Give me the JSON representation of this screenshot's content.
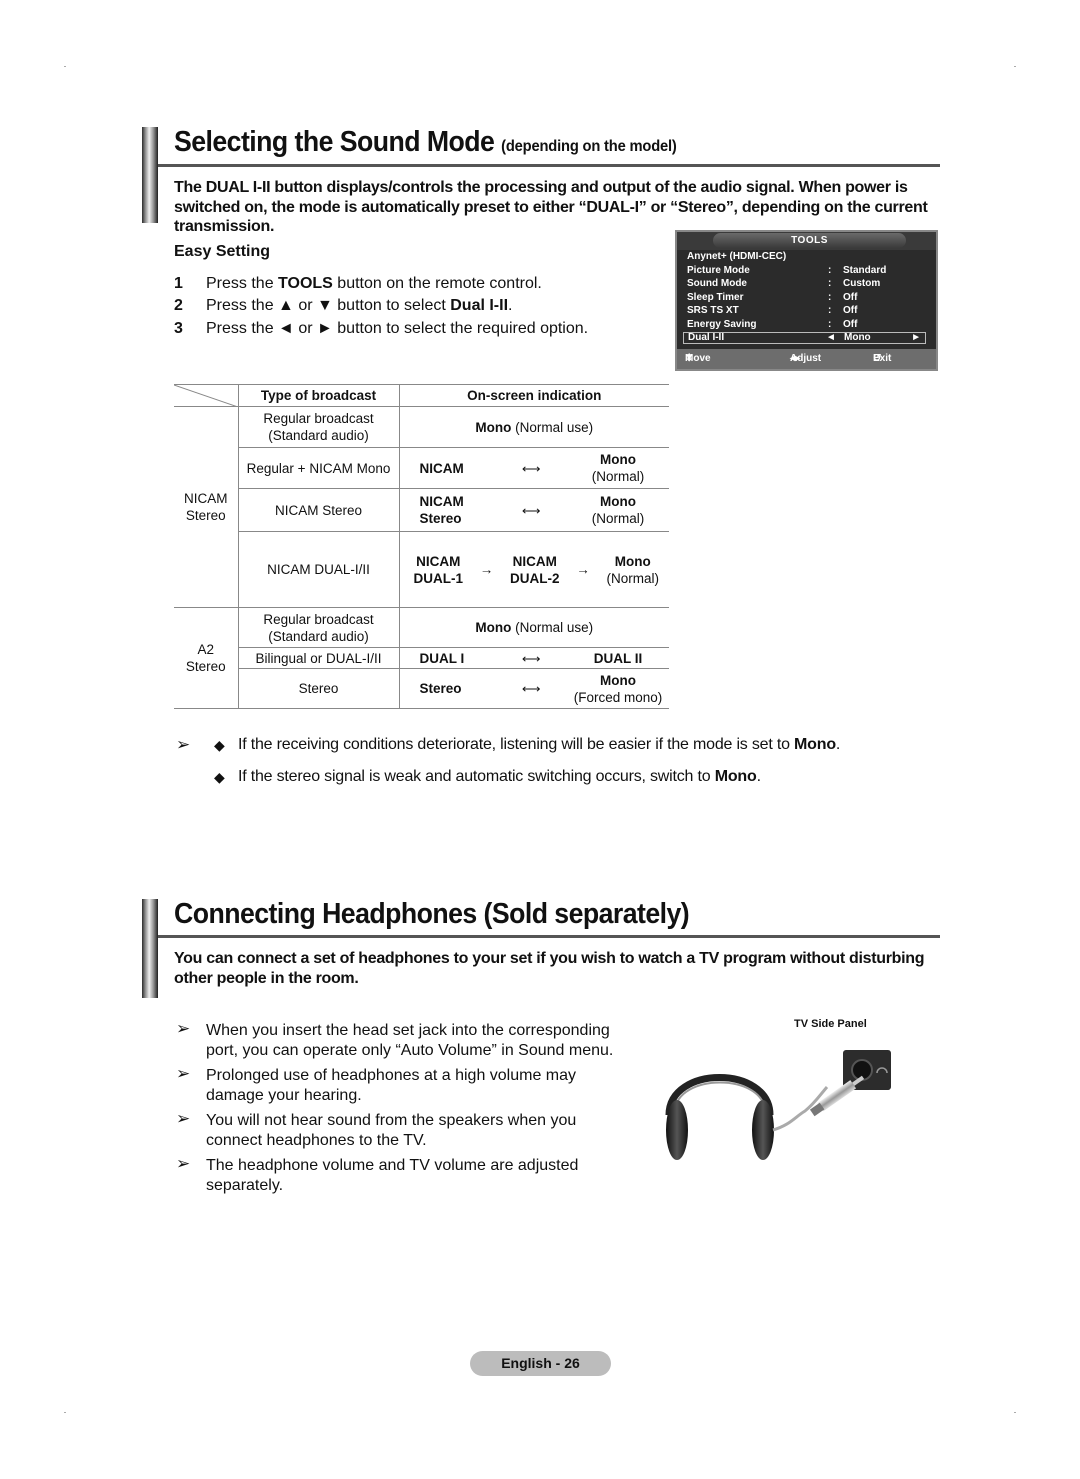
{
  "section1": {
    "title": "Selecting the Sound Mode",
    "subtitle": "(depending on the model)",
    "intro": "The DUAL I-II button displays/controls the processing and output of the audio signal. When power is switched on, the mode is automatically preset to either “DUAL-I” or “Stereo”, depending on the current transmission.",
    "easy_setting_title": "Easy Setting",
    "steps": [
      {
        "num": "1",
        "pre": "Press the ",
        "bold": "TOOLS",
        "post": " button on the remote control."
      },
      {
        "num": "2",
        "pre": "Press the ▲ or ▼ button to select ",
        "bold": "Dual I-II",
        "post": "."
      },
      {
        "num": "3",
        "pre": "Press the ◄ or ► button to select the required option.",
        "bold": "",
        "post": ""
      }
    ]
  },
  "tools_menu": {
    "title": "TOOLS",
    "items": [
      {
        "label": "Anynet+ (HDMI-CEC)",
        "value": ""
      },
      {
        "label": "Picture Mode",
        "value": "Standard"
      },
      {
        "label": "Sound Mode",
        "value": "Custom"
      },
      {
        "label": "Sleep Timer",
        "value": "Off"
      },
      {
        "label": "SRS TS XT",
        "value": "Off"
      },
      {
        "label": "Energy Saving",
        "value": "Off"
      }
    ],
    "selected": {
      "label": "Dual I-II",
      "value": "Mono",
      "left_arrow": "◄",
      "right_arrow": "►"
    },
    "footer": {
      "move": "Move",
      "adjust": "Adjust",
      "exit": "Exit"
    },
    "colon": ":"
  },
  "table": {
    "headers": [
      "Type of broadcast",
      "On-screen indication"
    ],
    "groups": [
      {
        "name_line1": "NICAM",
        "name_line2": "Stereo"
      },
      {
        "name_line1": "A2",
        "name_line2": "Stereo"
      }
    ],
    "rows": {
      "n_regular_type1": "Regular broadcast",
      "n_regular_type2": "(Standard audio)",
      "n_regular_ind_bold": "Mono",
      "n_regular_ind": " (Normal use)",
      "n_mono_type": "Regular + NICAM Mono",
      "n_mono_a": "NICAM",
      "n_mono_z1": "Mono",
      "n_mono_z2": "(Normal)",
      "n_stereo_type": "NICAM Stereo",
      "n_stereo_a1": "NICAM",
      "n_stereo_a2": "Stereo",
      "n_stereo_z1": "Mono",
      "n_stereo_z2": "(Normal)",
      "n_dual_type": "NICAM DUAL-I/II",
      "n_dual_a1": "NICAM",
      "n_dual_a2": "DUAL-1",
      "n_dual_b1": "NICAM",
      "n_dual_b2": "DUAL-2",
      "n_dual_z1": "Mono",
      "n_dual_z2": "(Normal)",
      "a_regular_type1": "Regular broadcast",
      "a_regular_type2": "(Standard audio)",
      "a_regular_ind_bold": "Mono",
      "a_regular_ind": " (Normal use)",
      "a_bi_type": "Bilingual or DUAL-I/II",
      "a_bi_a": "DUAL I",
      "a_bi_z": "DUAL II",
      "a_stereo_type": "Stereo",
      "a_stereo_a": "Stereo",
      "a_stereo_z1": "Mono",
      "a_stereo_z2": "(Forced mono)",
      "both_arrow": "⟷",
      "right_arrow": "→"
    }
  },
  "notes1": [
    {
      "pre": "If the receiving conditions deteriorate, listening will be easier if the mode is set to ",
      "bold": "Mono",
      "post": "."
    },
    {
      "pre": "If the stereo signal is weak and automatic switching occurs, switch to ",
      "bold": "Mono",
      "post": "."
    }
  ],
  "section2": {
    "title": "Connecting Headphones (Sold separately)",
    "intro": "You can connect a set of headphones to your set if you wish to watch a TV program without disturbing other people in the room.",
    "notes": [
      "When you insert the head set jack into the corresponding port, you can operate only “Auto Volume” in Sound menu.",
      "Prolonged use of headphones at a high volume may damage your hearing.",
      "You will not hear sound from the speakers when you connect headphones to the TV.",
      "The headphone volume and TV volume are adjusted separately."
    ],
    "panel_label": "TV Side Panel"
  },
  "glyphs": {
    "note_arrow": "➢",
    "diamond": "◆"
  },
  "footer": {
    "page_label": "English - 26"
  }
}
